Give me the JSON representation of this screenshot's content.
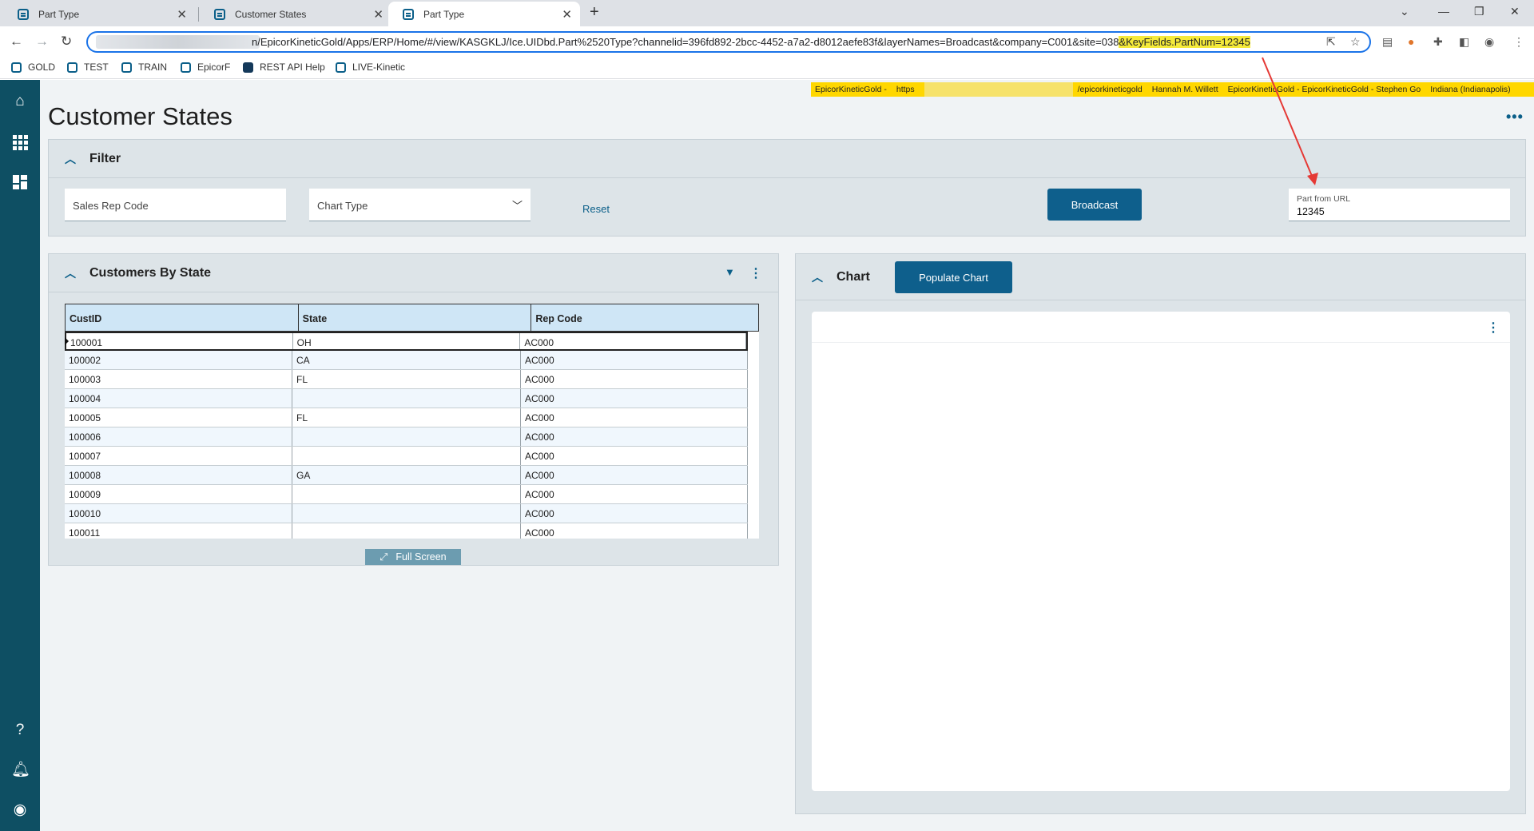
{
  "browser": {
    "tabs": [
      {
        "title": "Part Type"
      },
      {
        "title": "Customer States"
      },
      {
        "title": "Part Type"
      }
    ],
    "url": {
      "text": "n/EpicorKineticGold/Apps/ERP/Home/#/view/KASGKLJ/Ice.UIDbd.Part%2520Type?channelid=396fd892-2bcc-4452-a7a2-d8012aefe83f&layerNames=Broadcast&company=C001&site=038",
      "highlighted": "&KeyFields.PartNum=12345"
    },
    "bookmarks": [
      {
        "label": "GOLD"
      },
      {
        "label": "TEST"
      },
      {
        "label": "TRAIN"
      },
      {
        "label": "EpicorF"
      },
      {
        "label": "REST API Help"
      },
      {
        "label": "LIVE-Kinetic"
      }
    ]
  },
  "env_bar": {
    "product": "EpicorKineticGold -",
    "protocol": "https",
    "path": "/epicorkineticgold",
    "user": "Hannah M. Willett",
    "company": "EpicorKineticGold - EpicorKineticGold - Stephen Go",
    "site": "Indiana (Indianapolis)"
  },
  "page": {
    "title": "Customer States",
    "more": "•••"
  },
  "filter": {
    "title": "Filter",
    "sales_rep_placeholder": "Sales Rep Code",
    "chart_type_placeholder": "Chart Type",
    "reset_label": "Reset",
    "broadcast_label": "Broadcast",
    "part_from_url_label": "Part from URL",
    "part_from_url_value": "12345"
  },
  "customers": {
    "title": "Customers By State",
    "columns": [
      "CustID",
      "State",
      "Rep Code"
    ],
    "rows": [
      [
        "100001",
        "OH",
        "AC000"
      ],
      [
        "100002",
        "CA",
        "AC000"
      ],
      [
        "100003",
        "FL",
        "AC000"
      ],
      [
        "100004",
        "",
        "AC000"
      ],
      [
        "100005",
        "FL",
        "AC000"
      ],
      [
        "100006",
        "",
        "AC000"
      ],
      [
        "100007",
        "",
        "AC000"
      ],
      [
        "100008",
        "GA",
        "AC000"
      ],
      [
        "100009",
        "",
        "AC000"
      ],
      [
        "100010",
        "",
        "AC000"
      ],
      [
        "100011",
        "",
        "AC000"
      ]
    ],
    "fullscreen_label": "Full Screen"
  },
  "chart_panel": {
    "title": "Chart",
    "populate_label": "Populate Chart"
  },
  "colors": {
    "nav": "#0e4f63",
    "primary": "#0e5f8c",
    "highlight": "#f5ea3a",
    "annotation": "#e53935"
  }
}
